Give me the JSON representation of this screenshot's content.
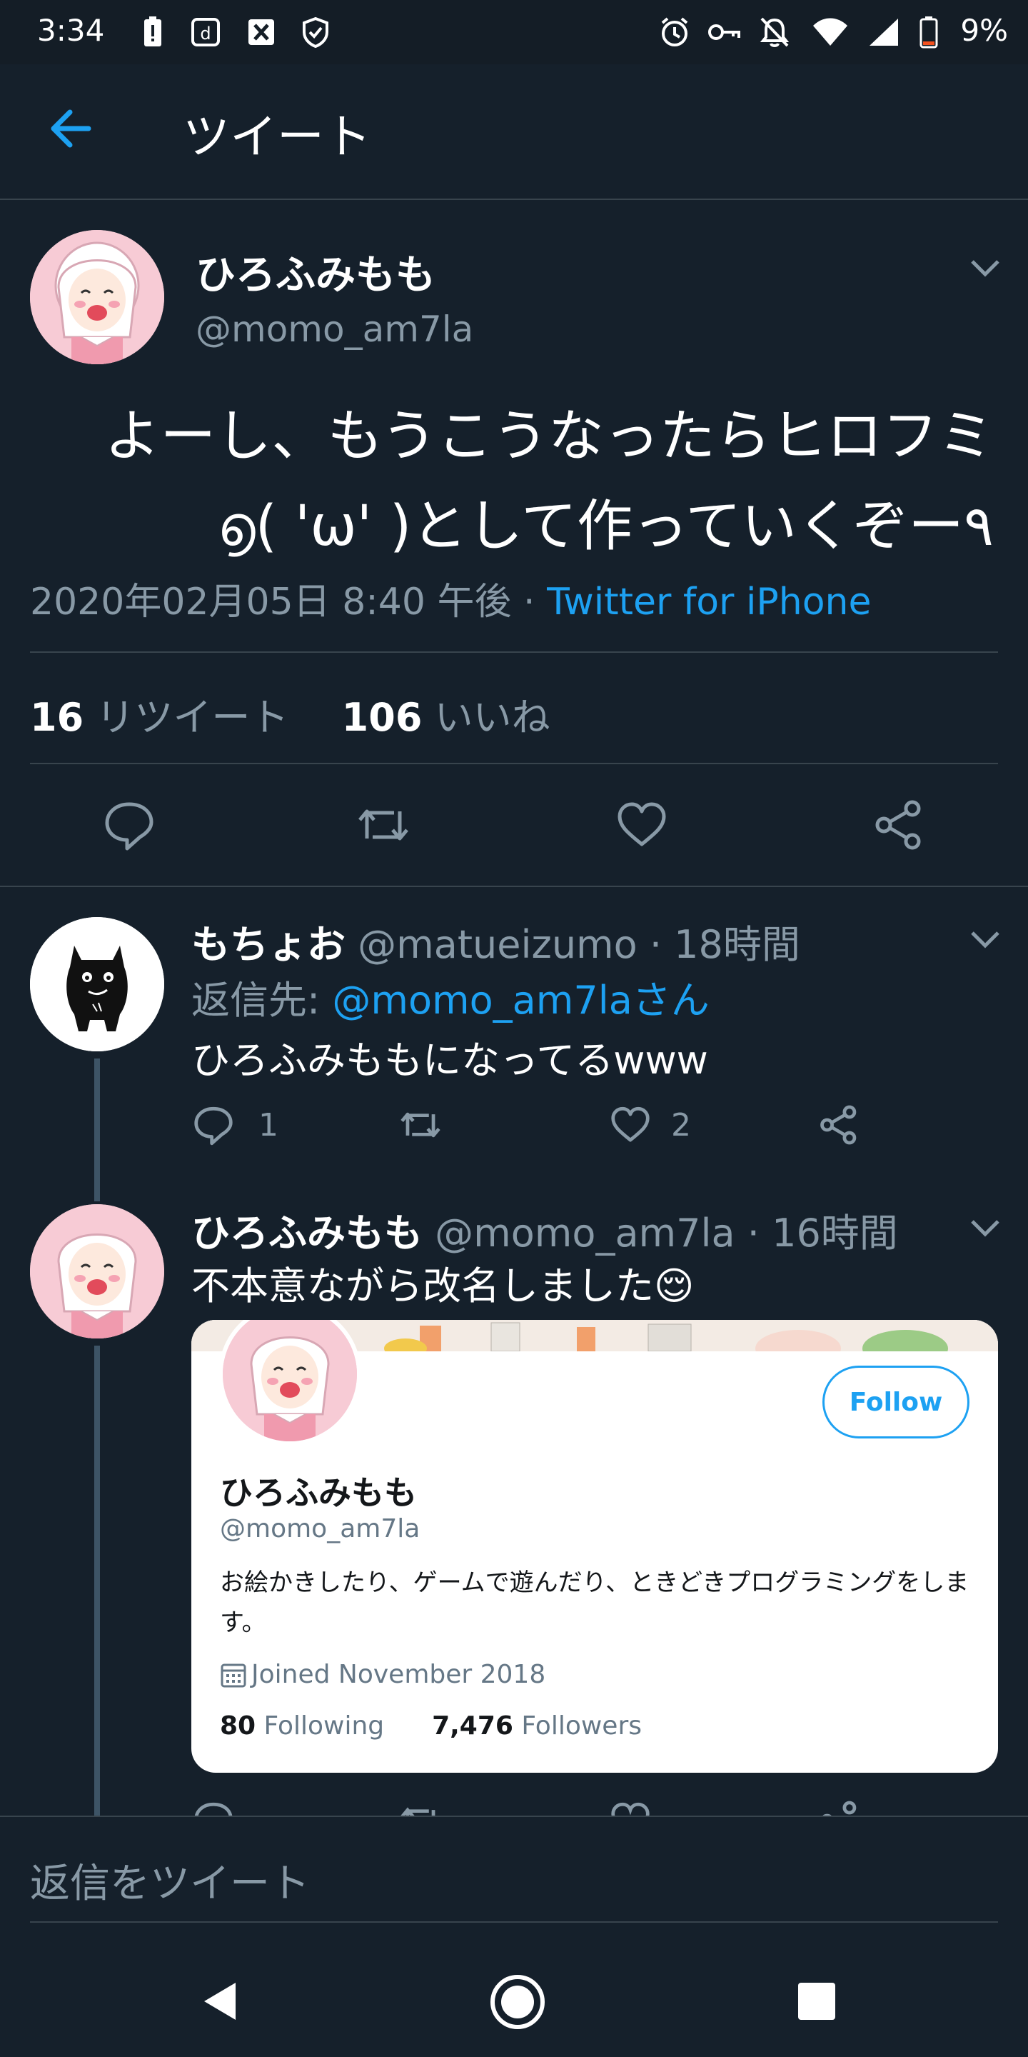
{
  "status_bar": {
    "time": "3:34",
    "battery": "9%"
  },
  "header": {
    "title": "ツイート"
  },
  "main_tweet": {
    "name": "ひろふみもも",
    "handle": "@momo_am7la",
    "text_line1": "よーし、もうこうなったらヒロフミ",
    "text_line2": "൭( 'ω' )として作っていくぞー٩",
    "timestamp": "2020年02月05日 8:40 午後",
    "separator": " · ",
    "source": "Twitter for iPhone",
    "retweet_count": "16",
    "retweet_label": " リツイート",
    "like_count": "106",
    "like_label": " いいね"
  },
  "reply1": {
    "name": "もちょお",
    "handle": " @matueizumo · 18時間",
    "reply_to_label": "返信先: ",
    "reply_to_handle": "@momo_am7laさん",
    "text": "ひろふみももになってるwww",
    "reply_count": "1",
    "like_count": "2"
  },
  "reply2": {
    "name": "ひろふみもも",
    "handle": " @momo_am7la · 16時間",
    "text": "不本意ながら改名しました😌",
    "card": {
      "follow_label": "Follow",
      "name": "ひろふみもも",
      "handle": "@momo_am7la",
      "bio": "お絵かきしたり、ゲームで遊んだり、ときどきプログラミングをします。",
      "joined": "Joined November 2018",
      "following_count": "80",
      "following_label": " Following",
      "followers_count": "7,476",
      "followers_label": " Followers"
    }
  },
  "compose": {
    "placeholder": "返信をツイート"
  },
  "colors": {
    "background": "#15202b",
    "accent": "#1da1f2",
    "muted_text": "#8899a6",
    "divider": "#38444d"
  }
}
